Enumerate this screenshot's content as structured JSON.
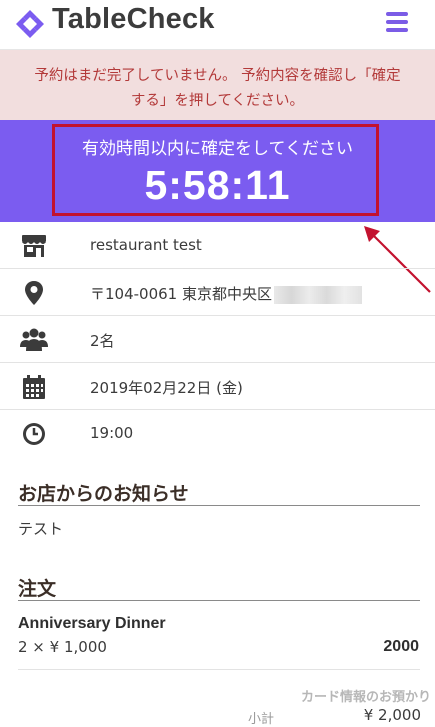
{
  "header": {
    "brand": "TableCheck",
    "logo_icon": "tablecheck-logo-icon",
    "menu_icon": "hamburger-menu-icon"
  },
  "alert": {
    "line1": "予約はまだ完了していません。 予約内容を確認し「確定",
    "line2": "する」を押してください。"
  },
  "timer": {
    "label": "有効時間以内に確定をしてください",
    "value": "5:58:11"
  },
  "details": [
    {
      "icon": "store-icon",
      "text": "restaurant test"
    },
    {
      "icon": "map-pin-icon",
      "text": "〒104-0061 東京都中央区"
    },
    {
      "icon": "users-icon",
      "text": "2名"
    },
    {
      "icon": "calendar-icon",
      "text": "2019年02月22日 (金)"
    },
    {
      "icon": "clock-icon",
      "text": "19:00"
    }
  ],
  "notice": {
    "title": "お店からのお知らせ",
    "body": "テスト"
  },
  "order": {
    "title": "注文",
    "item_name": "Anniversary Dinner",
    "item_qty": "2 × ¥ 1,000",
    "item_total": "2000"
  },
  "payment": {
    "card_note": "カード情報のお預かり",
    "subtotal_label": "小計",
    "subtotal_value": "¥ 2,000"
  },
  "colors": {
    "accent": "#7b5cf0",
    "alert_bg": "#f2dede",
    "alert_text": "#b33a3a",
    "highlight_border": "#c3122f"
  }
}
